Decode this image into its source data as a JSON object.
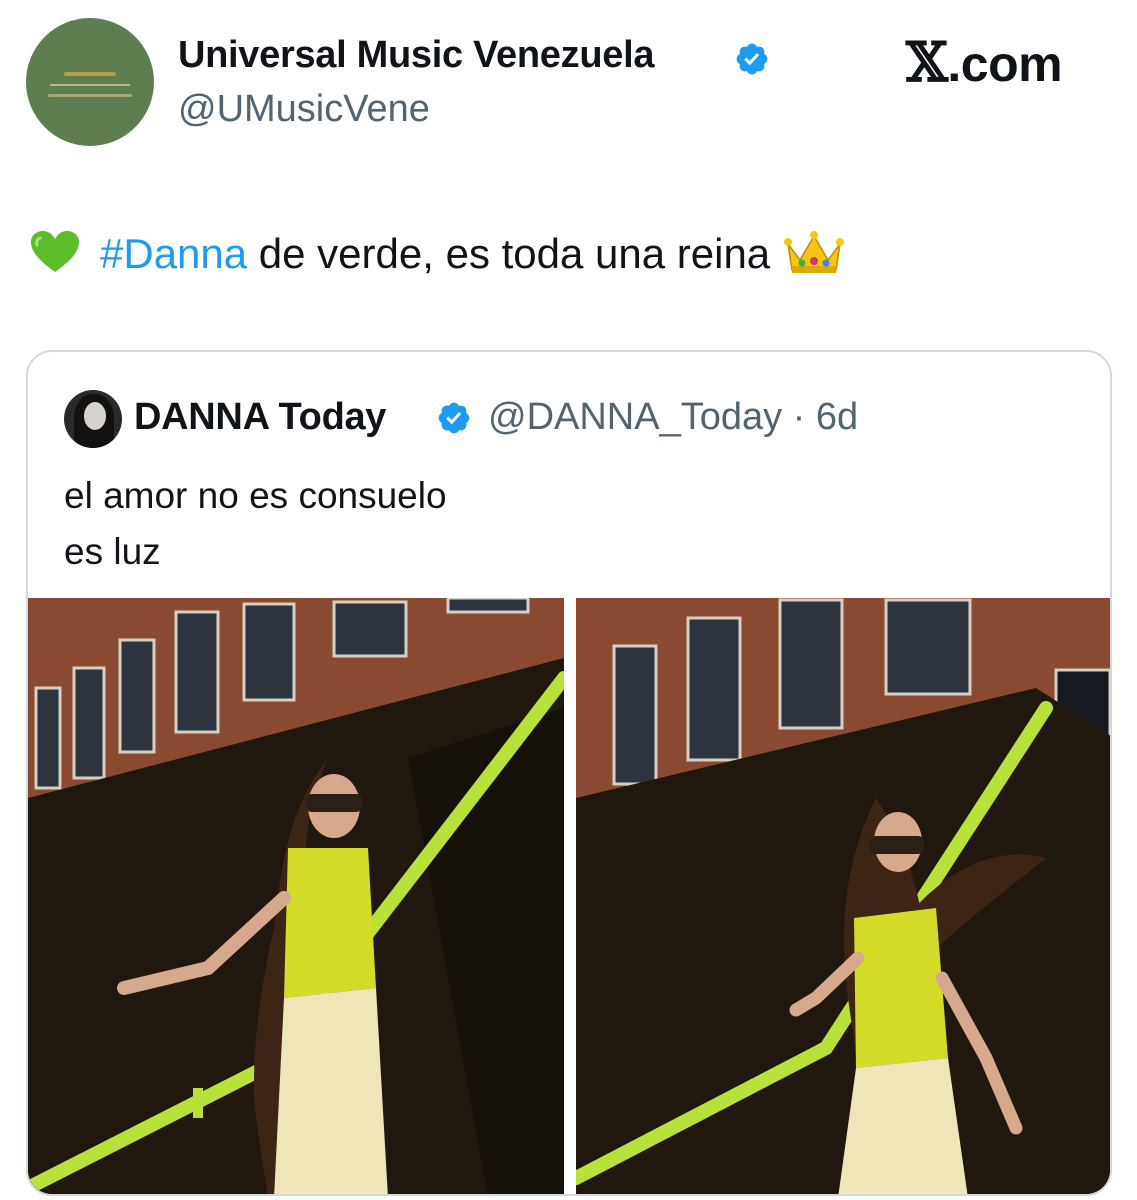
{
  "post": {
    "author": {
      "display_name": "Universal Music Venezuela",
      "handle": "@UMusicVene",
      "verified": true
    },
    "brand": "X.com",
    "text": {
      "heart_icon": "green-heart-emoji",
      "hashtag": "#Danna",
      "body": " de verde, es toda una reina",
      "crown_icon": "crown-emoji"
    }
  },
  "quoted_post": {
    "author": {
      "display_name": "DANNA Today",
      "handle_and_time": "@DANNA_Today · 6d",
      "verified": true
    },
    "text_lines": [
      "el amor no es consuelo",
      "es luz"
    ],
    "media_count": 2
  },
  "colors": {
    "link": "#1d9bf0",
    "verified_badge": "#1d9bf0",
    "muted_text": "#536471",
    "border": "#cfd9de",
    "avatar_bg": "#5e7e52"
  }
}
